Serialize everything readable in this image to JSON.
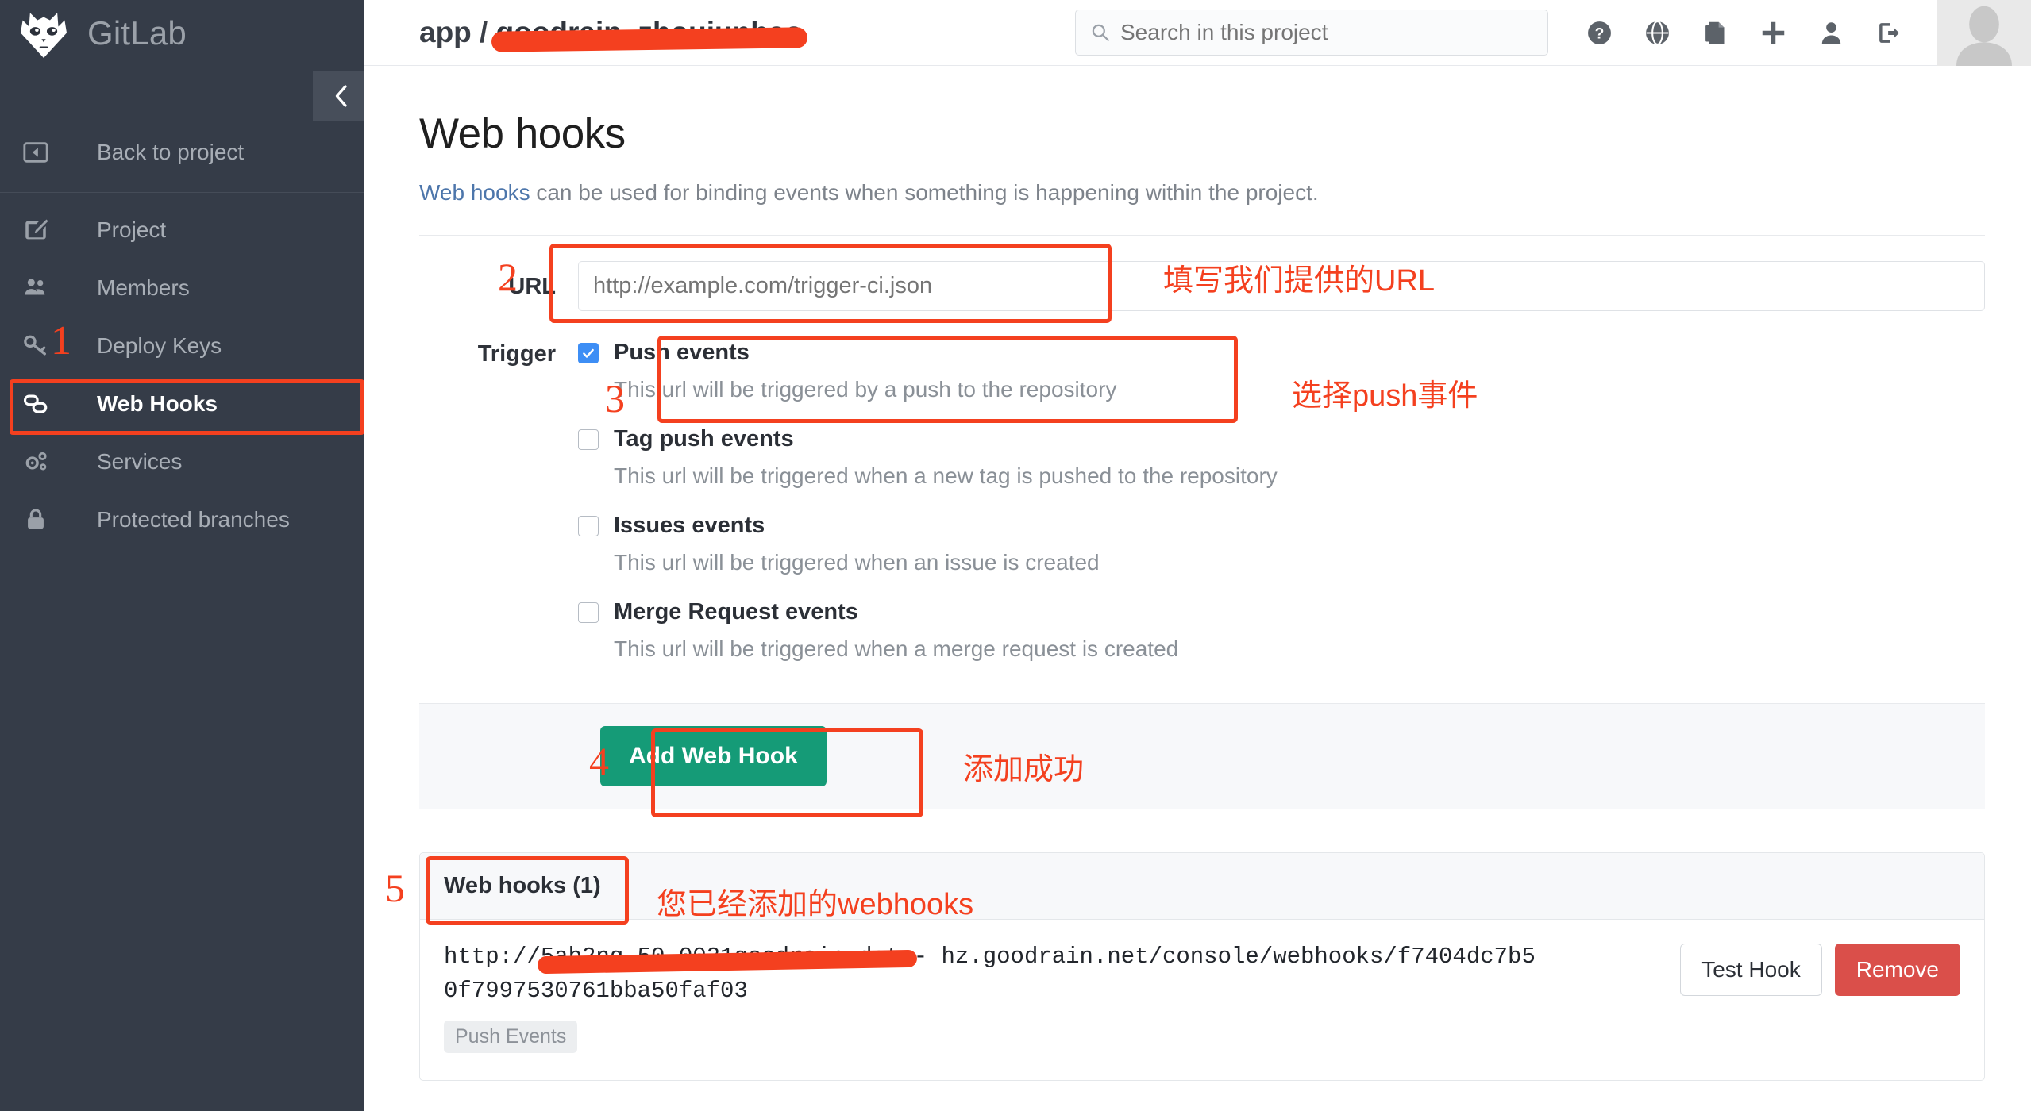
{
  "brand": {
    "name": "GitLab",
    "logo_icon": "gitlab-tanuki-logo"
  },
  "sidebar": {
    "collapse_icon": "chevron-left-icon",
    "back_item": {
      "label": "Back to project",
      "icon": "back-arrow-icon"
    },
    "items": [
      {
        "label": "Project",
        "icon": "edit-pencil-icon",
        "active": false
      },
      {
        "label": "Members",
        "icon": "users-group-icon",
        "active": false
      },
      {
        "label": "Deploy Keys",
        "icon": "key-icon",
        "active": false
      },
      {
        "label": "Web Hooks",
        "icon": "chain-link-icon",
        "active": true
      },
      {
        "label": "Services",
        "icon": "gears-icon",
        "active": false
      },
      {
        "label": "Protected branches",
        "icon": "lock-icon",
        "active": false
      }
    ]
  },
  "header": {
    "breadcrumb_prefix": "app /",
    "breadcrumb_project": "goodrain_zhoujunhao",
    "search": {
      "placeholder": "Search in this project",
      "value": "",
      "icon": "search-icon"
    },
    "icons": [
      {
        "name": "help-icon"
      },
      {
        "name": "globe-icon"
      },
      {
        "name": "clipboard-issues-icon"
      },
      {
        "name": "plus-icon"
      },
      {
        "name": "user-icon"
      },
      {
        "name": "logout-icon"
      }
    ],
    "avatar_icon": "avatar-placeholder-icon"
  },
  "page": {
    "title": "Web hooks",
    "desc_link": "Web hooks",
    "desc_rest": " can be used for binding events when something is happening within the project."
  },
  "form": {
    "url_label": "URL",
    "url_placeholder": "http://example.com/trigger-ci.json",
    "url_value": "",
    "trigger_label": "Trigger",
    "triggers": [
      {
        "title": "Push events",
        "desc": "This url will be triggered by a push to the repository",
        "checked": true
      },
      {
        "title": "Tag push events",
        "desc": "This url will be triggered when a new tag is pushed to the repository",
        "checked": false
      },
      {
        "title": "Issues events",
        "desc": "This url will be triggered when an issue is created",
        "checked": false
      },
      {
        "title": "Merge Request events",
        "desc": "This url will be triggered when a merge request is created",
        "checked": false
      }
    ],
    "submit_label": "Add Web Hook"
  },
  "hooks_panel": {
    "header": "Web hooks (1)",
    "rows": [
      {
        "url_prefix": "http://",
        "url_redacted": "5ab2ng-50-0021goodrain-data",
        "url_suffix": "-\nhz.goodrain.net/console/webhooks/f7404dc7b50f7997530761bba50faf03",
        "badge": "Push Events",
        "test_label": "Test Hook",
        "remove_label": "Remove"
      }
    ]
  },
  "annotations": {
    "accent_color": "#f4401f",
    "n1": "1",
    "n2": "2",
    "n3": "3",
    "n4": "4",
    "n5": "5",
    "t_url": "填写我们提供的URL",
    "t_push": "选择push事件",
    "t_add": "添加成功",
    "t_list": "您已经添加的webhooks"
  }
}
